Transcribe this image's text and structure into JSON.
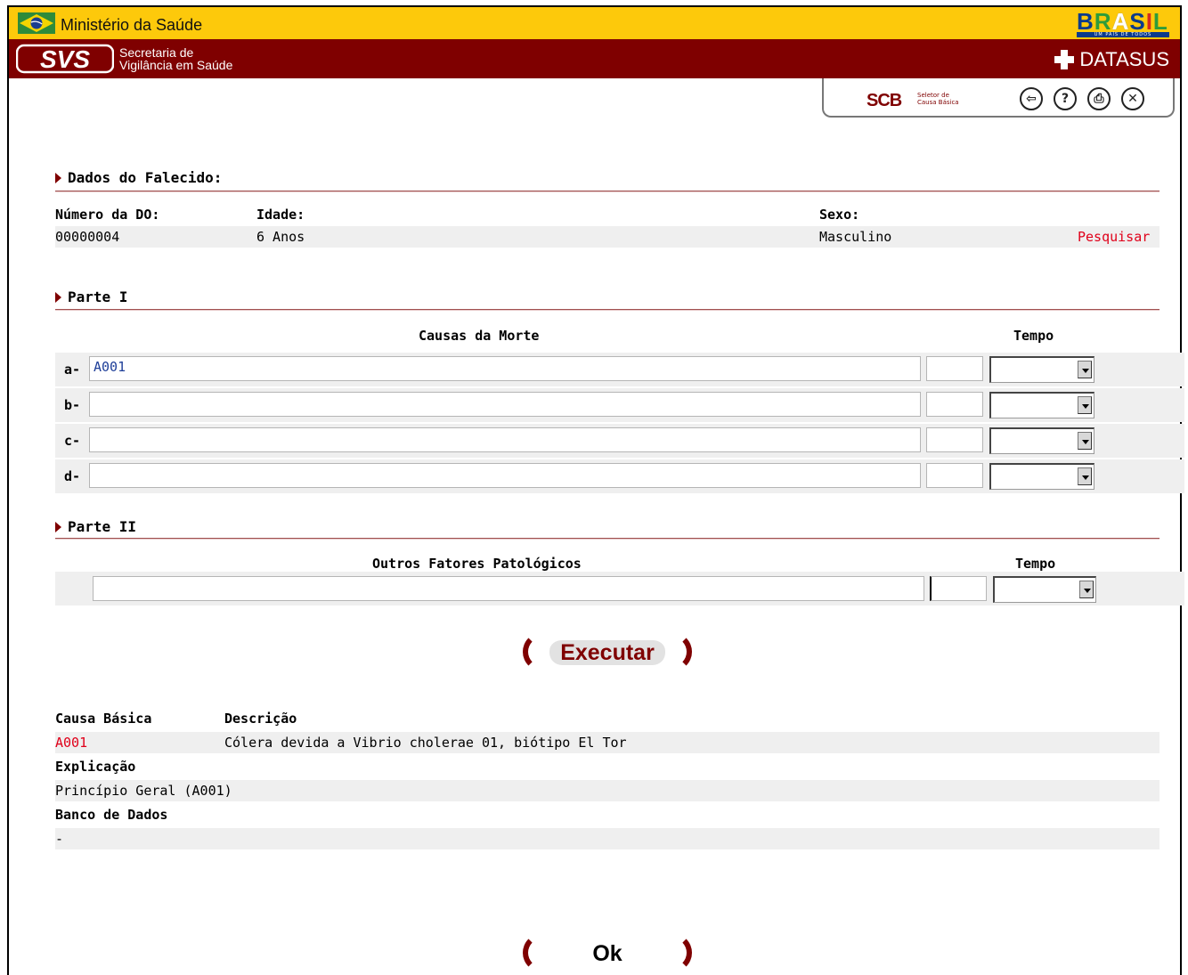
{
  "header": {
    "ministry_title": "Ministério da Saúde",
    "brasil_logo": "BRASIL",
    "brasil_tagline": "UM PAÍS DE TODOS",
    "svs_logo": "SVS",
    "svs_line1": "Secretaria de",
    "svs_line2": "Vigilância em Saúde",
    "datasus": "DATASUS",
    "scb_logo": "SCB",
    "scb_sub1": "Seletor de",
    "scb_sub2": "Causa Básica",
    "icons": [
      "back-icon",
      "help-icon",
      "print-icon",
      "close-icon"
    ],
    "colors": {
      "yellow": "#fdc90b",
      "dark_red": "#7f0000",
      "link_red": "#e0001a",
      "row_gray": "#efefef"
    }
  },
  "falecido": {
    "section_title": "Dados do Falecido:",
    "numero_label": "Número da DO:",
    "idade_label": "Idade:",
    "sexo_label": "Sexo:",
    "numero_value": "00000004",
    "idade_value": "6 Anos",
    "sexo_value": "Masculino",
    "pesquisar_link": "Pesquisar"
  },
  "parte1": {
    "section_title": "Parte I",
    "causas_header": "Causas da Morte",
    "tempo_header": "Tempo",
    "rows": [
      {
        "letter": "a-",
        "cause": "A001",
        "tempo": "",
        "unit": ""
      },
      {
        "letter": "b-",
        "cause": "",
        "tempo": "",
        "unit": ""
      },
      {
        "letter": "c-",
        "cause": "",
        "tempo": "",
        "unit": ""
      },
      {
        "letter": "d-",
        "cause": "",
        "tempo": "",
        "unit": ""
      }
    ]
  },
  "parte2": {
    "section_title": "Parte II",
    "outros_header": "Outros Fatores Patológicos",
    "tempo_header": "Tempo",
    "cause": "",
    "tempo": "",
    "unit": ""
  },
  "buttons": {
    "executar": "Executar",
    "ok": "Ok"
  },
  "resultado": {
    "causa_label": "Causa Básica",
    "descricao_label": "Descrição",
    "causa_value": "A001",
    "descricao_value": "Cólera devida a Vibrio cholerae 01, biótipo El Tor",
    "explicacao_label": "Explicação",
    "explicacao_value": "Princípio Geral (A001)",
    "banco_label": "Banco de Dados",
    "banco_value": "-"
  }
}
